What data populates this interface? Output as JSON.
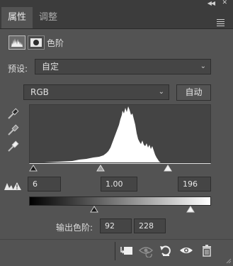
{
  "panel": {
    "tabs": [
      {
        "label": "属性"
      },
      {
        "label": "调整"
      }
    ],
    "adjustment_title": "色阶"
  },
  "preset": {
    "label": "预设:",
    "value": "自定"
  },
  "channel": {
    "value": "RGB",
    "auto_label": "自动"
  },
  "input_levels": {
    "black": "6",
    "gamma": "1.00",
    "white": "196"
  },
  "output_levels": {
    "label": "输出色阶:",
    "black": "92",
    "white": "228"
  },
  "colors": {
    "panel_bg": "#535353",
    "header_bg": "#3c3c3c",
    "field_bg": "#454545",
    "text": "#dcdcdc"
  },
  "icons": {
    "mask_tool": "histogram-icon",
    "mask_toggle": "mask-icon",
    "droppers": [
      "black-eyedropper-icon",
      "gray-eyedropper-icon",
      "white-eyedropper-icon"
    ],
    "bottom": [
      "clip-to-layer-icon",
      "view-previous-icon",
      "reset-icon",
      "visibility-icon",
      "trash-icon"
    ]
  }
}
